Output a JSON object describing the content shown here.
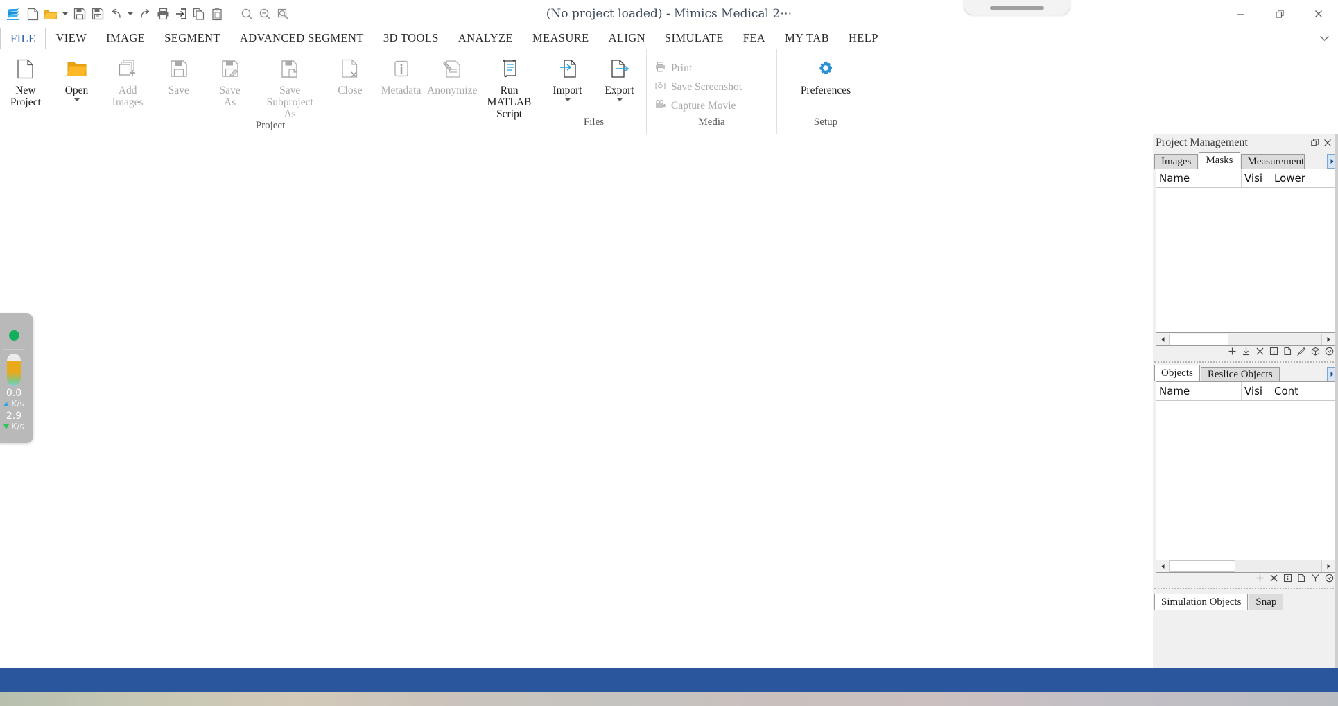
{
  "titlebar": {
    "title": "(No project loaded) - Mimics Medical 2⋯",
    "quick_access": [
      {
        "name": "app-logo-icon",
        "label": "Mimics"
      },
      {
        "name": "new-document-icon",
        "label": "New"
      },
      {
        "name": "open-folder-icon",
        "label": "Open"
      },
      {
        "name": "open-dropdown-caret-icon",
        "label": "Open options"
      },
      {
        "name": "save-icon",
        "label": "Save"
      },
      {
        "name": "save-as-icon",
        "label": "Save As"
      },
      {
        "name": "undo-icon",
        "label": "Undo"
      },
      {
        "name": "undo-dropdown-caret-icon",
        "label": "Undo history"
      },
      {
        "name": "redo-icon",
        "label": "Redo"
      },
      {
        "name": "print-icon",
        "label": "Print"
      },
      {
        "name": "import-icon",
        "label": "Import"
      },
      {
        "name": "copy-icon",
        "label": "Copy"
      },
      {
        "name": "paste-icon",
        "label": "Paste"
      },
      {
        "name": "zoom-in-icon",
        "label": "Zoom In"
      },
      {
        "name": "zoom-out-icon",
        "label": "Zoom Out"
      },
      {
        "name": "zoom-fit-icon",
        "label": "Fit"
      }
    ],
    "window_controls": [
      {
        "name": "minimize-button",
        "label": "Minimize"
      },
      {
        "name": "restore-button",
        "label": "Restore"
      },
      {
        "name": "close-button",
        "label": "Close"
      }
    ]
  },
  "ribbon_tabs": [
    {
      "label": "FILE",
      "active": true
    },
    {
      "label": "VIEW",
      "active": false
    },
    {
      "label": "IMAGE",
      "active": false
    },
    {
      "label": "SEGMENT",
      "active": false
    },
    {
      "label": "ADVANCED SEGMENT",
      "active": false
    },
    {
      "label": "3D TOOLS",
      "active": false
    },
    {
      "label": "ANALYZE",
      "active": false
    },
    {
      "label": "MEASURE",
      "active": false
    },
    {
      "label": "ALIGN",
      "active": false
    },
    {
      "label": "SIMULATE",
      "active": false
    },
    {
      "label": "FEA",
      "active": false
    },
    {
      "label": "MY TAB",
      "active": false
    },
    {
      "label": "HELP",
      "active": false
    }
  ],
  "ribbon": {
    "groups": [
      {
        "label": "Project",
        "buttons": [
          {
            "label": "New\nProject",
            "icon": "new-project-icon",
            "enabled": true,
            "dropdown": false
          },
          {
            "label": "Open",
            "icon": "open-project-icon",
            "enabled": true,
            "dropdown": true
          },
          {
            "label": "Add\nImages",
            "icon": "add-images-icon",
            "enabled": false,
            "dropdown": false
          },
          {
            "label": "Save",
            "icon": "save-project-icon",
            "enabled": false,
            "dropdown": false
          },
          {
            "label": "Save\nAs",
            "icon": "save-as-icon",
            "enabled": false,
            "dropdown": false
          },
          {
            "label": "Save Subproject\nAs",
            "icon": "save-subproject-icon",
            "enabled": false,
            "dropdown": false
          },
          {
            "label": "Close",
            "icon": "close-project-icon",
            "enabled": false,
            "dropdown": false
          },
          {
            "label": "Metadata",
            "icon": "metadata-info-icon",
            "enabled": false,
            "dropdown": false
          },
          {
            "label": "Anonymize",
            "icon": "anonymize-icon",
            "enabled": false,
            "dropdown": false
          },
          {
            "label": "Run MATLAB\nScript",
            "icon": "matlab-script-icon",
            "enabled": true,
            "dropdown": false
          }
        ]
      },
      {
        "label": "Files",
        "buttons": [
          {
            "label": "Import",
            "icon": "import-file-icon",
            "enabled": true,
            "dropdown": true
          },
          {
            "label": "Export",
            "icon": "export-file-icon",
            "enabled": true,
            "dropdown": true
          }
        ]
      },
      {
        "label": "Media",
        "small_items": [
          {
            "label": "Print",
            "icon": "print-icon",
            "enabled": false
          },
          {
            "label": "Save Screenshot",
            "icon": "camera-icon",
            "enabled": false
          },
          {
            "label": "Capture Movie",
            "icon": "movie-camera-icon",
            "enabled": false
          }
        ]
      },
      {
        "label": "Setup",
        "buttons": [
          {
            "label": "Preferences",
            "icon": "gear-icon",
            "enabled": true,
            "dropdown": false
          }
        ]
      }
    ]
  },
  "net_widget": {
    "status_name": "network-status-indicator",
    "upload_value": "0.0",
    "upload_unit": "K/s",
    "download_value": "2.9",
    "download_unit": "K/s"
  },
  "dock": {
    "title": "Project Management",
    "title_buttons": [
      {
        "name": "undock-panel-button",
        "label": "Undock"
      },
      {
        "name": "close-panel-button",
        "label": "Close"
      }
    ],
    "top_panel": {
      "tabs": [
        {
          "label": "Images",
          "active": false
        },
        {
          "label": "Masks",
          "active": true
        },
        {
          "label": "Measurements",
          "active": false
        }
      ],
      "columns": [
        "Name",
        "Visi",
        "Lower"
      ],
      "rows": [],
      "tools": [
        "add-icon",
        "import-icon",
        "delete-icon",
        "info-icon",
        "duplicate-icon",
        "edit-icon",
        "3d-icon",
        "more-icon"
      ]
    },
    "bottom_panel": {
      "tabs": [
        {
          "label": "Objects",
          "active": true
        },
        {
          "label": "Reslice Objects",
          "active": false
        }
      ],
      "columns": [
        "Name",
        "Visi",
        "Cont"
      ],
      "rows": [],
      "tools": [
        "add-icon",
        "delete-icon",
        "info-icon",
        "duplicate-icon",
        "branch-icon",
        "more-icon"
      ]
    },
    "footer_tabs": [
      {
        "label": "Simulation Objects",
        "active": true
      },
      {
        "label": "Snap",
        "active": false
      }
    ]
  }
}
